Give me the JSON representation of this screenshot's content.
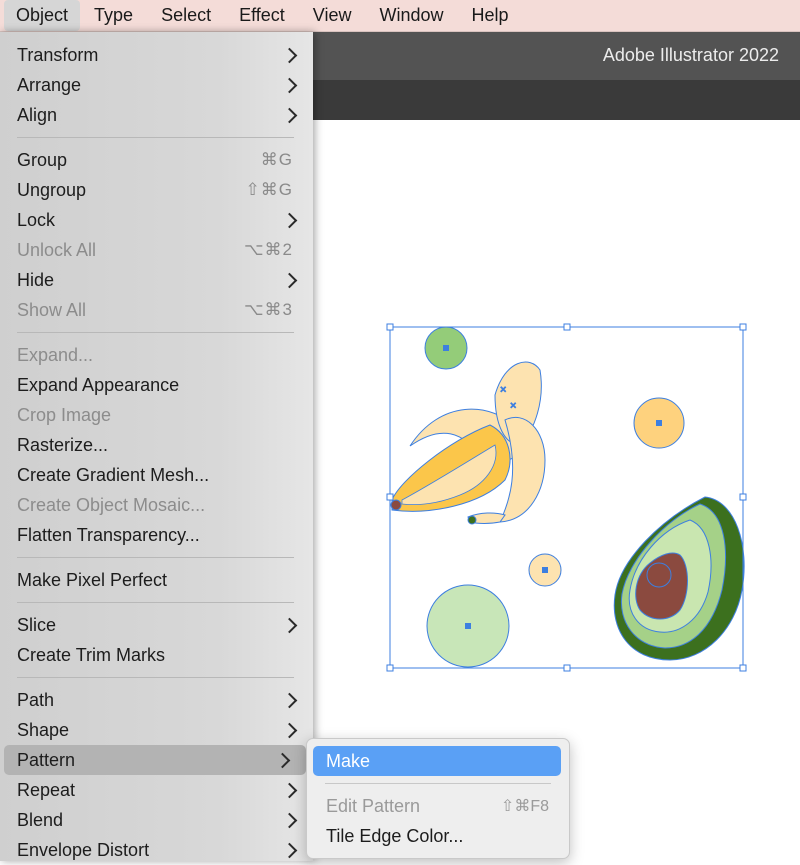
{
  "menubar": {
    "items": [
      "Object",
      "Type",
      "Select",
      "Effect",
      "View",
      "Window",
      "Help"
    ]
  },
  "app": {
    "title": "Adobe Illustrator 2022"
  },
  "object_menu": {
    "items": [
      {
        "label": "Transform",
        "submenu": true
      },
      {
        "label": "Arrange",
        "submenu": true
      },
      {
        "label": "Align",
        "submenu": true
      },
      {
        "label": "Group",
        "shortcut": "⌘G"
      },
      {
        "label": "Ungroup",
        "shortcut": "⇧⌘G"
      },
      {
        "label": "Lock",
        "submenu": true
      },
      {
        "label": "Unlock All",
        "shortcut": "⌥⌘2",
        "disabled": true
      },
      {
        "label": "Hide",
        "submenu": true
      },
      {
        "label": "Show All",
        "shortcut": "⌥⌘3",
        "disabled": true
      },
      {
        "label": "Expand...",
        "disabled": true
      },
      {
        "label": "Expand Appearance"
      },
      {
        "label": "Crop Image",
        "disabled": true
      },
      {
        "label": "Rasterize..."
      },
      {
        "label": "Create Gradient Mesh..."
      },
      {
        "label": "Create Object Mosaic...",
        "disabled": true
      },
      {
        "label": "Flatten Transparency..."
      },
      {
        "label": "Make Pixel Perfect"
      },
      {
        "label": "Slice",
        "submenu": true
      },
      {
        "label": "Create Trim Marks"
      },
      {
        "label": "Path",
        "submenu": true
      },
      {
        "label": "Shape",
        "submenu": true
      },
      {
        "label": "Pattern",
        "submenu": true,
        "highlighted": true
      },
      {
        "label": "Repeat",
        "submenu": true
      },
      {
        "label": "Blend",
        "submenu": true
      },
      {
        "label": "Envelope Distort",
        "submenu": true
      }
    ]
  },
  "pattern_submenu": {
    "items": [
      {
        "label": "Make",
        "highlighted": true
      },
      {
        "label": "Edit Pattern",
        "shortcut": "⇧⌘F8",
        "disabled": true
      },
      {
        "label": "Tile Edge Color..."
      }
    ]
  },
  "colors": {
    "selection": "#3d7fe0",
    "banana_fill": "#fde3b0",
    "banana_deep": "#fbc64a",
    "avocado_dark": "#3c701e",
    "avocado_mid": "#a5d188",
    "avocado_light": "#c9e6b0",
    "avocado_pit": "#8b4a3f",
    "green_dot": "#94cc79",
    "orange_dot": "#fed27e",
    "light_green_dot": "#c8e6b8"
  }
}
